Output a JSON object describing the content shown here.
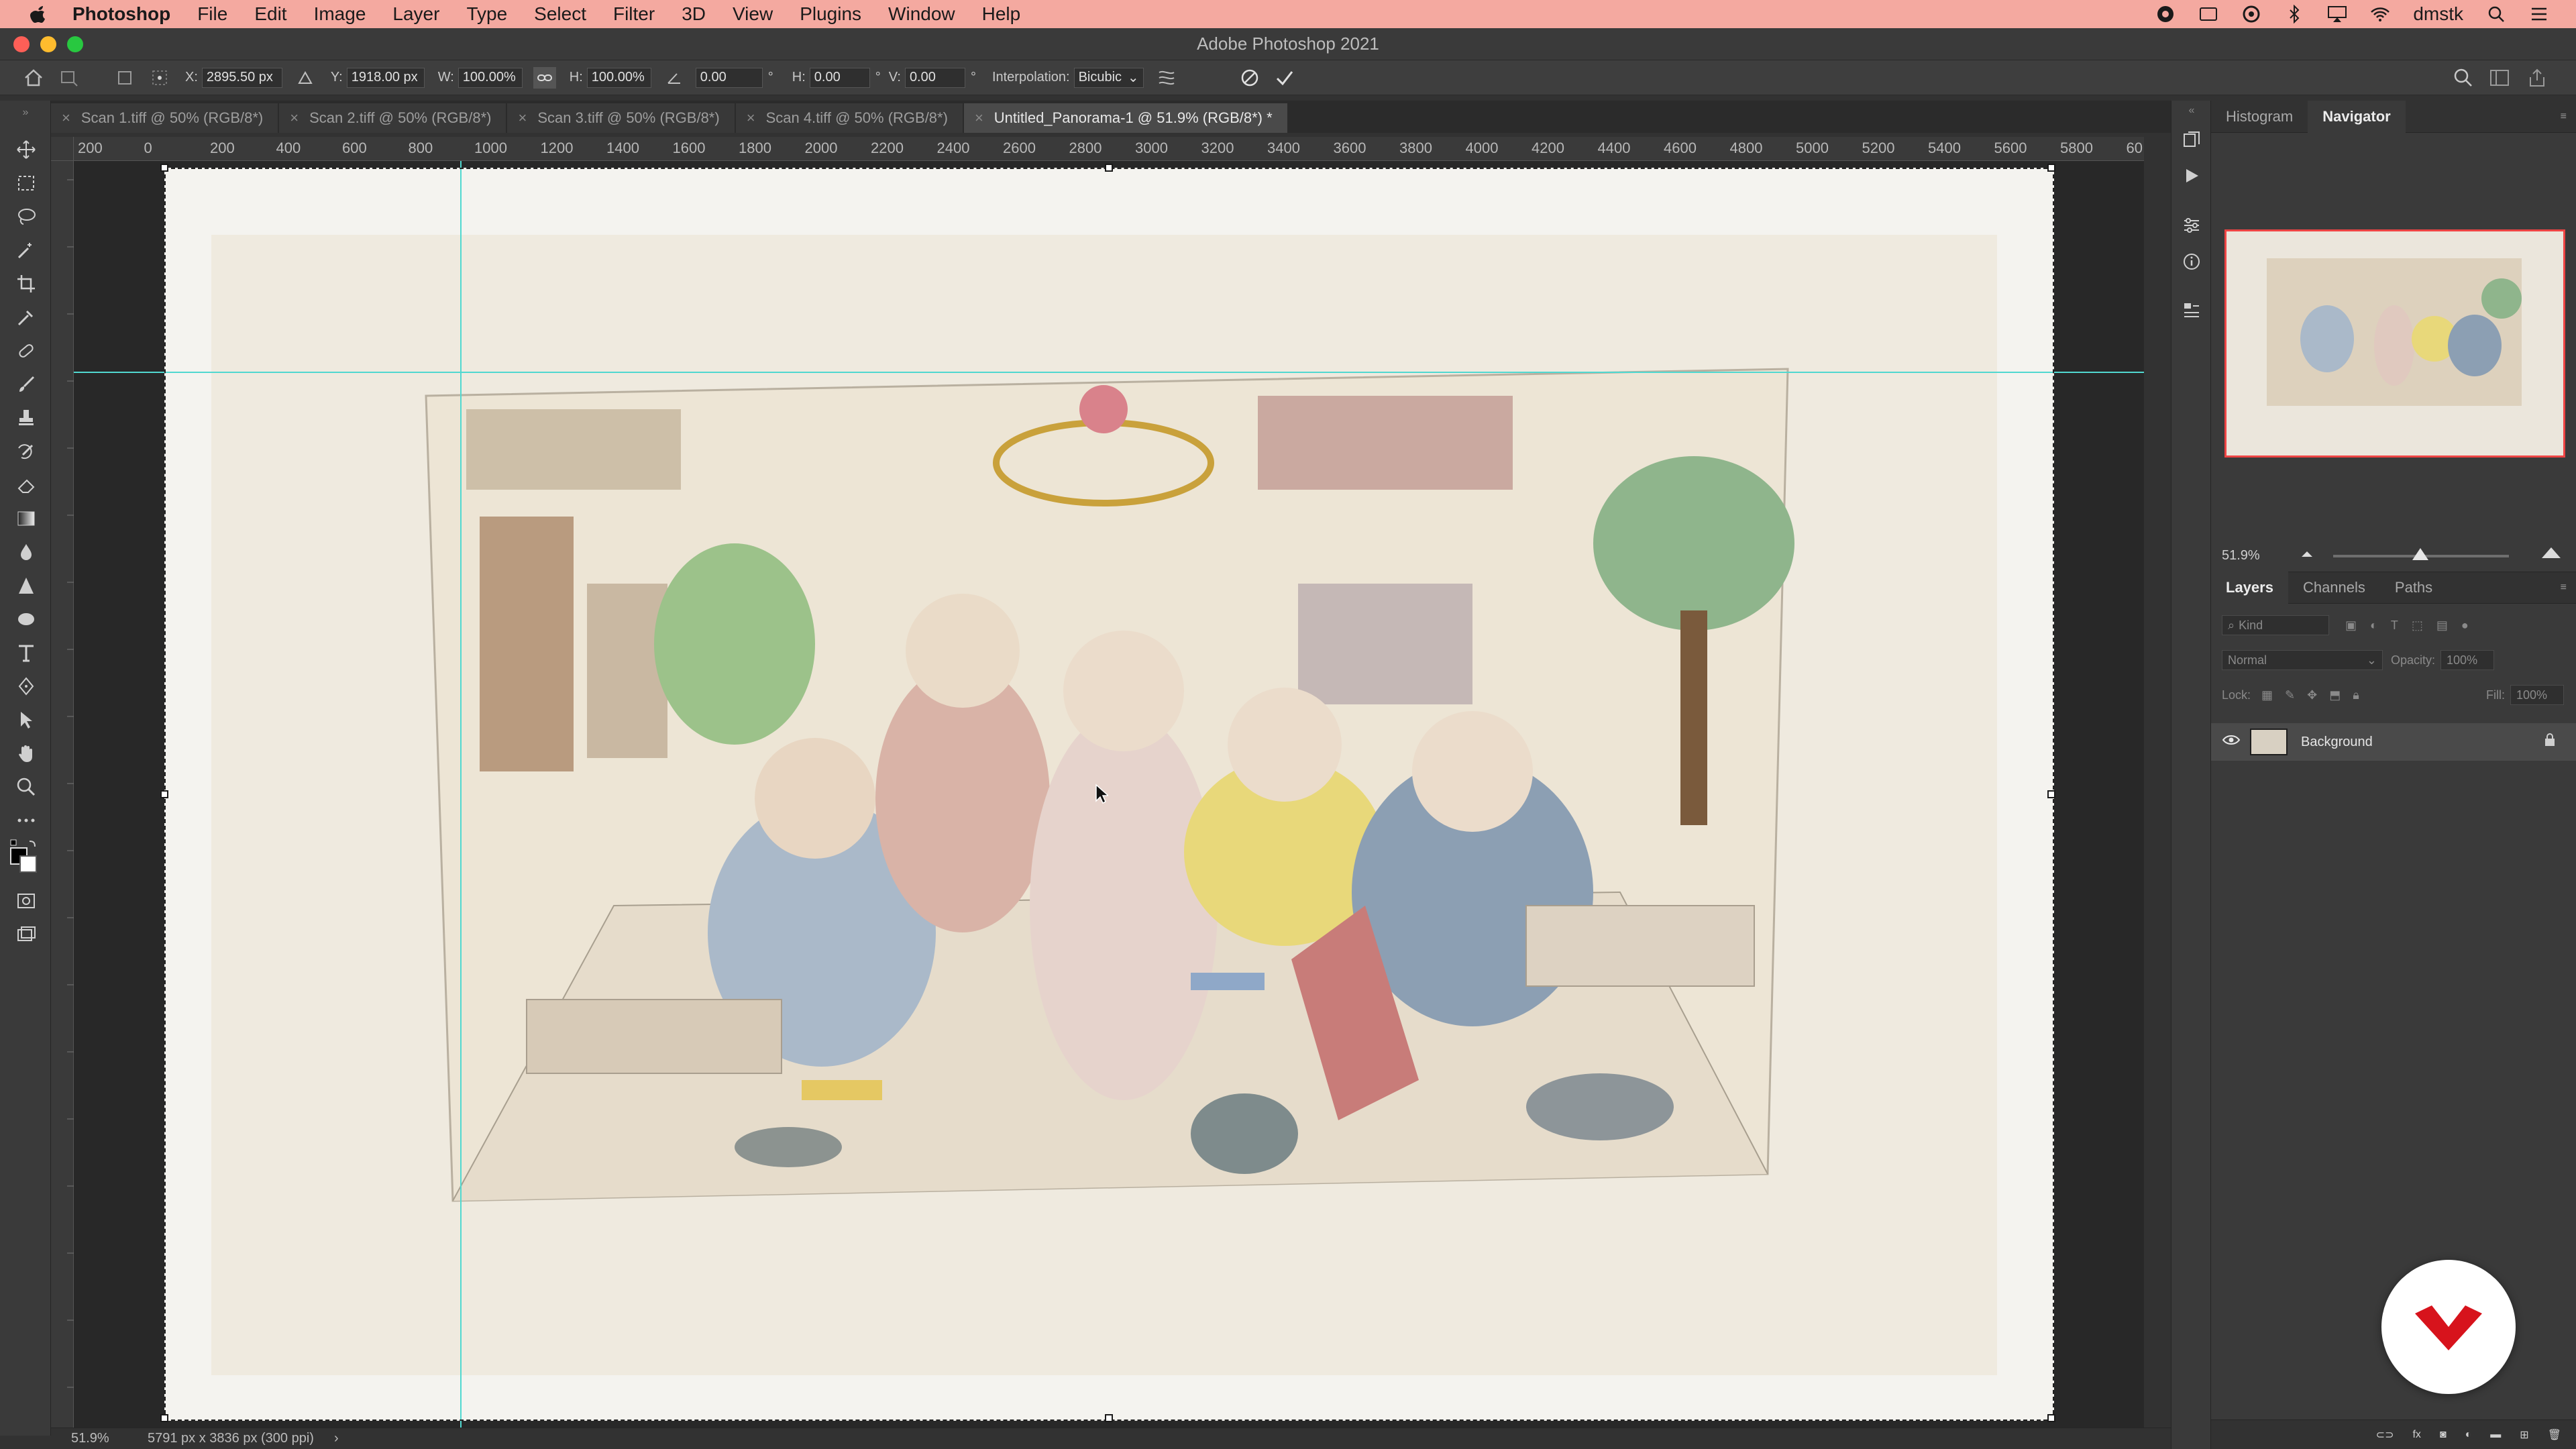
{
  "menubar": {
    "app_name": "Photoshop",
    "items": [
      "File",
      "Edit",
      "Image",
      "Layer",
      "Type",
      "Select",
      "Filter",
      "3D",
      "View",
      "Plugins",
      "Window",
      "Help"
    ],
    "username": "dmstk"
  },
  "window": {
    "title": "Adobe Photoshop 2021"
  },
  "options": {
    "x_label": "X:",
    "x_value": "2895.50 px",
    "y_label": "Y:",
    "y_value": "1918.00 px",
    "w_label": "W:",
    "w_value": "100.00%",
    "h_label": "H:",
    "h_value": "100.00%",
    "angle_value": "0.00",
    "hskew_label": "H:",
    "hskew_value": "0.00",
    "vskew_label": "V:",
    "vskew_value": "0.00",
    "interp_label": "Interpolation:",
    "interp_value": "Bicubic"
  },
  "tabs": [
    {
      "label": "Scan 1.tiff @ 50% (RGB/8*)",
      "active": false
    },
    {
      "label": "Scan 2.tiff @ 50% (RGB/8*)",
      "active": false
    },
    {
      "label": "Scan 3.tiff @ 50% (RGB/8*)",
      "active": false
    },
    {
      "label": "Scan 4.tiff @ 50% (RGB/8*)",
      "active": false
    },
    {
      "label": "Untitled_Panorama-1 @ 51.9% (RGB/8*) *",
      "active": true
    }
  ],
  "ruler_h": [
    "200",
    "0",
    "200",
    "400",
    "600",
    "800",
    "1000",
    "1200",
    "1400",
    "1600",
    "1800",
    "2000",
    "2200",
    "2400",
    "2600",
    "2800",
    "3000",
    "3200",
    "3400",
    "3600",
    "3800",
    "4000",
    "4200",
    "4400",
    "4600",
    "4800",
    "5000",
    "5200",
    "5400",
    "5600",
    "5800",
    "60"
  ],
  "status": {
    "zoom": "51.9%",
    "doc_info": "5791 px x 3836 px (300 ppi)"
  },
  "panels": {
    "top_tabs": [
      "Histogram",
      "Navigator"
    ],
    "navigator_zoom": "51.9%",
    "navigator_zoom_fraction": 0.19,
    "layers_tabs": [
      "Layers",
      "Channels",
      "Paths"
    ],
    "kind_placeholder": "Kind",
    "blend_mode": "Normal",
    "opacity_label": "Opacity:",
    "opacity_value": "100%",
    "lock_label": "Lock:",
    "fill_label": "Fill:",
    "fill_value": "100%",
    "layer_name": "Background"
  },
  "colors": {
    "menubar_bg": "#f4a9a0",
    "guide": "#51d8d0",
    "active_tab": "#4a4a4a",
    "badge_red": "#d7131c"
  }
}
